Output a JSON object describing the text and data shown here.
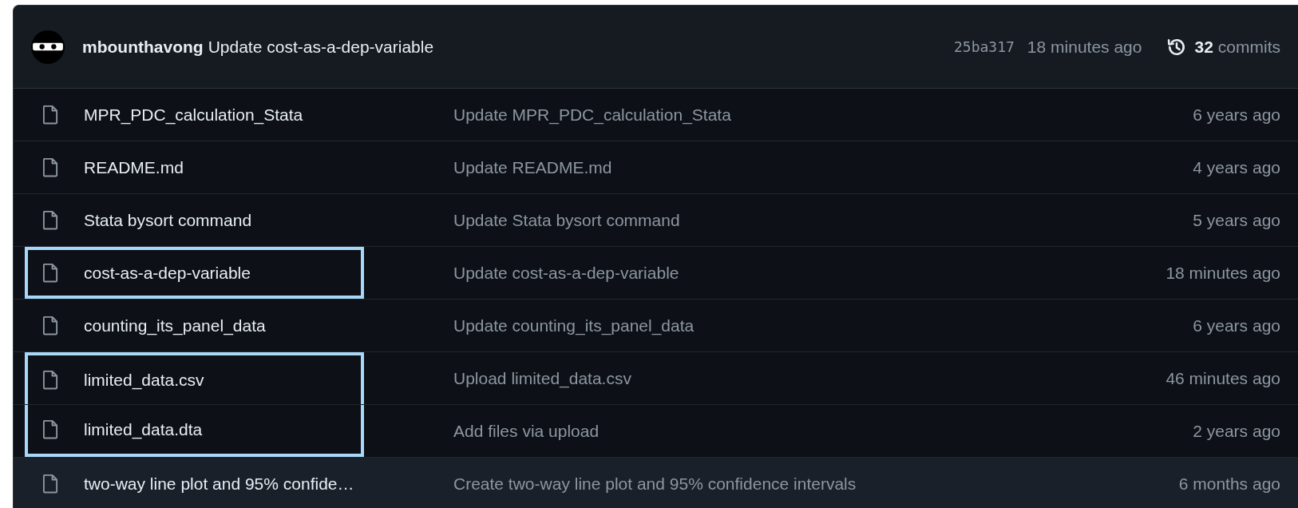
{
  "commit_header": {
    "author": "mbounthavong",
    "message": "Update cost-as-a-dep-variable",
    "sha": "25ba317",
    "age": "18 minutes ago",
    "commit_count": "32",
    "commit_label": "commits"
  },
  "files": [
    {
      "name": "MPR_PDC_calculation_Stata",
      "message": "Update MPR_PDC_calculation_Stata",
      "age": "6 years ago",
      "highlighted": false,
      "hovered": false
    },
    {
      "name": "README.md",
      "message": "Update README.md",
      "age": "4 years ago",
      "highlighted": false,
      "hovered": false
    },
    {
      "name": "Stata bysort command",
      "message": "Update Stata bysort command",
      "age": "5 years ago",
      "highlighted": false,
      "hovered": false
    },
    {
      "name": "cost-as-a-dep-variable",
      "message": "Update cost-as-a-dep-variable",
      "age": "18 minutes ago",
      "highlighted": true,
      "hovered": false
    },
    {
      "name": "counting_its_panel_data",
      "message": "Update counting_its_panel_data",
      "age": "6 years ago",
      "highlighted": false,
      "hovered": false
    },
    {
      "name": "limited_data.csv",
      "message": "Upload limited_data.csv",
      "age": "46 minutes ago",
      "highlighted": true,
      "hovered": false
    },
    {
      "name": "limited_data.dta",
      "message": "Add files via upload",
      "age": "2 years ago",
      "highlighted": true,
      "hovered": false
    },
    {
      "name": "two-way line plot and 95% confide…",
      "message": "Create two-way line plot and 95% confidence intervals",
      "age": "6 months ago",
      "highlighted": false,
      "hovered": true
    }
  ]
}
